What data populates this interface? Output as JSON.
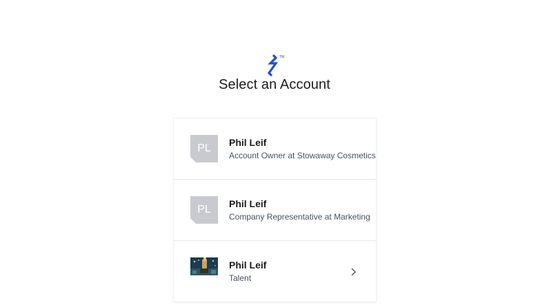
{
  "brand": {
    "logo": "toptal-logo-icon",
    "accent": "#204ecf"
  },
  "page": {
    "title": "Select an Account"
  },
  "accounts": [
    {
      "initials": "PL",
      "name": "Phil Leif",
      "role": "Account Owner at Stowaway Cosmetics",
      "avatar": "initials"
    },
    {
      "initials": "PL",
      "name": "Phil Leif",
      "role": "Company Representative at Marketing",
      "avatar": "initials"
    },
    {
      "initials": "",
      "name": "Phil Leif",
      "role": "Talent",
      "avatar": "photo"
    }
  ],
  "icons": {
    "row_arrow": "chevron-right-icon"
  }
}
